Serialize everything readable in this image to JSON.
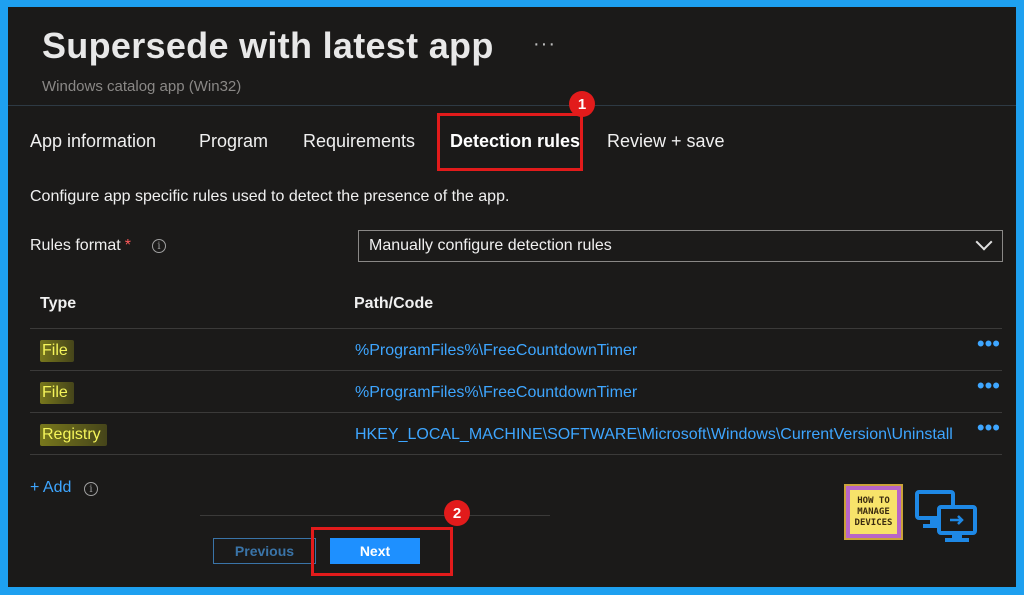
{
  "header": {
    "title": "Supersede with latest app",
    "more_label": "···",
    "subtitle": "Windows catalog app (Win32)"
  },
  "tabs": [
    {
      "label": "App information",
      "active": false
    },
    {
      "label": "Program",
      "active": false
    },
    {
      "label": "Requirements",
      "active": false
    },
    {
      "label": "Detection rules",
      "active": true
    },
    {
      "label": "Review + save",
      "active": false
    }
  ],
  "annotations": {
    "step1": "1",
    "step2": "2",
    "color": "#e21b1b"
  },
  "description": "Configure app specific rules used to detect the presence of the app.",
  "rules_format": {
    "label": "Rules format",
    "required_mark": "*",
    "info_icon": "info-icon",
    "value": "Manually configure detection rules"
  },
  "table": {
    "headers": {
      "type": "Type",
      "path": "Path/Code"
    },
    "rows": [
      {
        "type": "File",
        "path": "%ProgramFiles%\\FreeCountdownTimer",
        "more": "•••"
      },
      {
        "type": "File",
        "path": "%ProgramFiles%\\FreeCountdownTimer",
        "more": "•••"
      },
      {
        "type": "Registry",
        "path": "HKEY_LOCAL_MACHINE\\SOFTWARE\\Microsoft\\Windows\\CurrentVersion\\Uninstall",
        "more": "•••"
      }
    ]
  },
  "add": {
    "label": "+ Add"
  },
  "buttons": {
    "previous": "Previous",
    "next": "Next"
  },
  "logo": {
    "line1": "HOW TO",
    "line2": "MANAGE",
    "line3": "DEVICES"
  },
  "colors": {
    "accent": "#3ea6ff",
    "button": "#1e90ff",
    "background": "#1b1a19",
    "border": "#1ea0f0"
  }
}
